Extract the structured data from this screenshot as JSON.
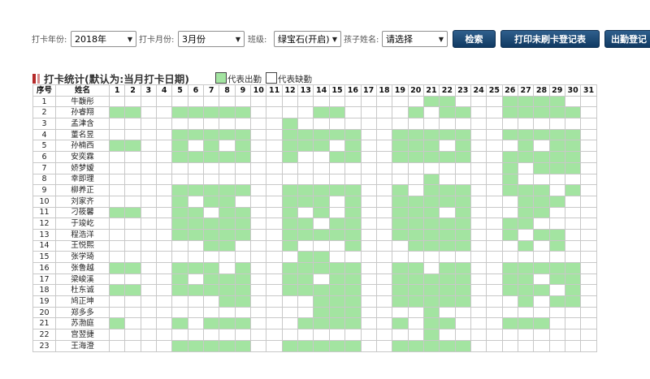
{
  "filters": {
    "year_label": "打卡年份:",
    "year_value": "2018年",
    "month_label": "打卡月份:",
    "month_value": "3月份",
    "class_label": "班级:",
    "class_value": "绿宝石(开启)",
    "child_label": "孩子姓名:",
    "child_value": "请选择"
  },
  "buttons": {
    "search": "检索",
    "print_unswiped": "打印未刷卡登记表",
    "attendance": "出勤登记"
  },
  "section": {
    "title": "打卡统计(默认为:当月打卡日期)",
    "legend_present": "代表出勤",
    "legend_absent": "代表缺勤"
  },
  "colors": {
    "present": "#a3e4a1",
    "button": "#1d4a76",
    "title_bar": "#b52a2a"
  },
  "table": {
    "col_index": "序号",
    "col_name": "姓名",
    "days": [
      "1",
      "2",
      "3",
      "4",
      "5",
      "6",
      "7",
      "8",
      "9",
      "10",
      "11",
      "12",
      "13",
      "14",
      "15",
      "16",
      "17",
      "18",
      "19",
      "20",
      "21",
      "22",
      "23",
      "24",
      "25",
      "26",
      "27",
      "28",
      "29",
      "30",
      "31"
    ],
    "rows": [
      {
        "index": "1",
        "name": "牛馥彤",
        "present": [
          21,
          22,
          26,
          27,
          28,
          29
        ]
      },
      {
        "index": "2",
        "name": "孙睿翔",
        "present": [
          1,
          2,
          5,
          6,
          7,
          8,
          9,
          14,
          15,
          20,
          22,
          23,
          26,
          27,
          28,
          29,
          30
        ]
      },
      {
        "index": "3",
        "name": "孟津含",
        "present": [
          12
        ]
      },
      {
        "index": "4",
        "name": "董名昱",
        "present": [
          5,
          6,
          7,
          8,
          9,
          12,
          13,
          14,
          15,
          16,
          19,
          20,
          21,
          22,
          23,
          26,
          27,
          28,
          29,
          30
        ]
      },
      {
        "index": "5",
        "name": "孙楠西",
        "present": [
          1,
          2,
          5,
          7,
          9,
          12,
          13,
          14,
          16,
          19,
          20,
          21,
          23,
          27,
          29,
          30
        ]
      },
      {
        "index": "6",
        "name": "安奕霖",
        "present": [
          5,
          6,
          7,
          8,
          9,
          12,
          15,
          16,
          19,
          20,
          21,
          22,
          23,
          26,
          27,
          28,
          29,
          30
        ]
      },
      {
        "index": "7",
        "name": "娇梦嫒",
        "present": [
          26,
          28,
          29,
          30
        ]
      },
      {
        "index": "8",
        "name": "幸即理",
        "present": [
          21,
          26
        ]
      },
      {
        "index": "9",
        "name": "柳养正",
        "present": [
          5,
          6,
          7,
          8,
          9,
          12,
          13,
          14,
          15,
          16,
          19,
          21,
          22,
          23,
          26,
          27,
          28,
          30
        ]
      },
      {
        "index": "10",
        "name": "刘家齐",
        "present": [
          5,
          7,
          8,
          12,
          13,
          14,
          16,
          19,
          20,
          21,
          22,
          23,
          27,
          28,
          29
        ]
      },
      {
        "index": "11",
        "name": "刁筱馨",
        "present": [
          1,
          2,
          5,
          6,
          8,
          9,
          12,
          14,
          16,
          19,
          20,
          21,
          23,
          27,
          28
        ]
      },
      {
        "index": "12",
        "name": "于竣屹",
        "present": [
          5,
          6,
          7,
          8,
          9,
          12,
          13,
          15,
          16,
          19,
          20,
          21,
          22,
          23,
          26,
          27
        ]
      },
      {
        "index": "13",
        "name": "程浩洋",
        "present": [
          5,
          6,
          7,
          8,
          9,
          12,
          13,
          14,
          15,
          16,
          19,
          20,
          21,
          22,
          23,
          26,
          28,
          29
        ]
      },
      {
        "index": "14",
        "name": "王悦熙",
        "present": [
          7,
          8,
          12,
          16,
          20,
          21,
          22,
          23,
          27,
          29
        ]
      },
      {
        "index": "15",
        "name": "张学琦",
        "present": [
          13,
          14
        ]
      },
      {
        "index": "16",
        "name": "张鲁越",
        "present": [
          1,
          2,
          5,
          6,
          7,
          9,
          12,
          13,
          14,
          15,
          16,
          19,
          20,
          22,
          23,
          26,
          27,
          28,
          29,
          30
        ]
      },
      {
        "index": "17",
        "name": "梁峻溪",
        "present": [
          5,
          7,
          8,
          9,
          12,
          13,
          15,
          16,
          19,
          20,
          21,
          22,
          23,
          26,
          27,
          29,
          30
        ]
      },
      {
        "index": "18",
        "name": "杜东诚",
        "present": [
          1,
          2,
          5,
          6,
          7,
          8,
          9,
          12,
          13,
          14,
          15,
          16,
          19,
          20,
          21,
          22,
          23,
          26,
          27,
          28,
          30
        ]
      },
      {
        "index": "19",
        "name": "鸠正坤",
        "present": [
          8,
          9,
          14,
          15,
          16,
          19,
          20,
          21,
          22,
          23,
          27,
          29,
          30
        ]
      },
      {
        "index": "20",
        "name": "郑多多",
        "present": [
          14,
          15,
          16,
          21
        ]
      },
      {
        "index": "21",
        "name": "苏渤庭",
        "present": [
          1,
          5,
          7,
          8,
          9,
          13,
          14,
          15,
          16,
          19,
          21,
          22,
          26,
          27,
          28
        ]
      },
      {
        "index": "22",
        "name": "宫翌捷",
        "present": [
          21
        ]
      },
      {
        "index": "23",
        "name": "王海澄",
        "present": [
          5,
          6,
          7,
          8,
          9,
          12,
          13,
          14,
          15,
          16,
          19,
          20,
          21,
          22,
          23
        ]
      }
    ]
  }
}
